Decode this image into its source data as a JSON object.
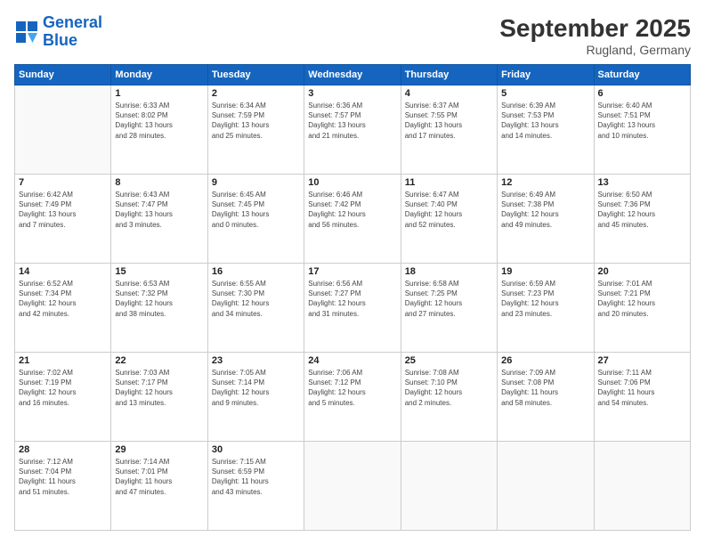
{
  "header": {
    "logo_line1": "General",
    "logo_line2": "Blue",
    "month": "September 2025",
    "location": "Rugland, Germany"
  },
  "weekdays": [
    "Sunday",
    "Monday",
    "Tuesday",
    "Wednesday",
    "Thursday",
    "Friday",
    "Saturday"
  ],
  "weeks": [
    [
      {
        "day": "",
        "info": ""
      },
      {
        "day": "1",
        "info": "Sunrise: 6:33 AM\nSunset: 8:02 PM\nDaylight: 13 hours\nand 28 minutes."
      },
      {
        "day": "2",
        "info": "Sunrise: 6:34 AM\nSunset: 7:59 PM\nDaylight: 13 hours\nand 25 minutes."
      },
      {
        "day": "3",
        "info": "Sunrise: 6:36 AM\nSunset: 7:57 PM\nDaylight: 13 hours\nand 21 minutes."
      },
      {
        "day": "4",
        "info": "Sunrise: 6:37 AM\nSunset: 7:55 PM\nDaylight: 13 hours\nand 17 minutes."
      },
      {
        "day": "5",
        "info": "Sunrise: 6:39 AM\nSunset: 7:53 PM\nDaylight: 13 hours\nand 14 minutes."
      },
      {
        "day": "6",
        "info": "Sunrise: 6:40 AM\nSunset: 7:51 PM\nDaylight: 13 hours\nand 10 minutes."
      }
    ],
    [
      {
        "day": "7",
        "info": "Sunrise: 6:42 AM\nSunset: 7:49 PM\nDaylight: 13 hours\nand 7 minutes."
      },
      {
        "day": "8",
        "info": "Sunrise: 6:43 AM\nSunset: 7:47 PM\nDaylight: 13 hours\nand 3 minutes."
      },
      {
        "day": "9",
        "info": "Sunrise: 6:45 AM\nSunset: 7:45 PM\nDaylight: 13 hours\nand 0 minutes."
      },
      {
        "day": "10",
        "info": "Sunrise: 6:46 AM\nSunset: 7:42 PM\nDaylight: 12 hours\nand 56 minutes."
      },
      {
        "day": "11",
        "info": "Sunrise: 6:47 AM\nSunset: 7:40 PM\nDaylight: 12 hours\nand 52 minutes."
      },
      {
        "day": "12",
        "info": "Sunrise: 6:49 AM\nSunset: 7:38 PM\nDaylight: 12 hours\nand 49 minutes."
      },
      {
        "day": "13",
        "info": "Sunrise: 6:50 AM\nSunset: 7:36 PM\nDaylight: 12 hours\nand 45 minutes."
      }
    ],
    [
      {
        "day": "14",
        "info": "Sunrise: 6:52 AM\nSunset: 7:34 PM\nDaylight: 12 hours\nand 42 minutes."
      },
      {
        "day": "15",
        "info": "Sunrise: 6:53 AM\nSunset: 7:32 PM\nDaylight: 12 hours\nand 38 minutes."
      },
      {
        "day": "16",
        "info": "Sunrise: 6:55 AM\nSunset: 7:30 PM\nDaylight: 12 hours\nand 34 minutes."
      },
      {
        "day": "17",
        "info": "Sunrise: 6:56 AM\nSunset: 7:27 PM\nDaylight: 12 hours\nand 31 minutes."
      },
      {
        "day": "18",
        "info": "Sunrise: 6:58 AM\nSunset: 7:25 PM\nDaylight: 12 hours\nand 27 minutes."
      },
      {
        "day": "19",
        "info": "Sunrise: 6:59 AM\nSunset: 7:23 PM\nDaylight: 12 hours\nand 23 minutes."
      },
      {
        "day": "20",
        "info": "Sunrise: 7:01 AM\nSunset: 7:21 PM\nDaylight: 12 hours\nand 20 minutes."
      }
    ],
    [
      {
        "day": "21",
        "info": "Sunrise: 7:02 AM\nSunset: 7:19 PM\nDaylight: 12 hours\nand 16 minutes."
      },
      {
        "day": "22",
        "info": "Sunrise: 7:03 AM\nSunset: 7:17 PM\nDaylight: 12 hours\nand 13 minutes."
      },
      {
        "day": "23",
        "info": "Sunrise: 7:05 AM\nSunset: 7:14 PM\nDaylight: 12 hours\nand 9 minutes."
      },
      {
        "day": "24",
        "info": "Sunrise: 7:06 AM\nSunset: 7:12 PM\nDaylight: 12 hours\nand 5 minutes."
      },
      {
        "day": "25",
        "info": "Sunrise: 7:08 AM\nSunset: 7:10 PM\nDaylight: 12 hours\nand 2 minutes."
      },
      {
        "day": "26",
        "info": "Sunrise: 7:09 AM\nSunset: 7:08 PM\nDaylight: 11 hours\nand 58 minutes."
      },
      {
        "day": "27",
        "info": "Sunrise: 7:11 AM\nSunset: 7:06 PM\nDaylight: 11 hours\nand 54 minutes."
      }
    ],
    [
      {
        "day": "28",
        "info": "Sunrise: 7:12 AM\nSunset: 7:04 PM\nDaylight: 11 hours\nand 51 minutes."
      },
      {
        "day": "29",
        "info": "Sunrise: 7:14 AM\nSunset: 7:01 PM\nDaylight: 11 hours\nand 47 minutes."
      },
      {
        "day": "30",
        "info": "Sunrise: 7:15 AM\nSunset: 6:59 PM\nDaylight: 11 hours\nand 43 minutes."
      },
      {
        "day": "",
        "info": ""
      },
      {
        "day": "",
        "info": ""
      },
      {
        "day": "",
        "info": ""
      },
      {
        "day": "",
        "info": ""
      }
    ]
  ]
}
